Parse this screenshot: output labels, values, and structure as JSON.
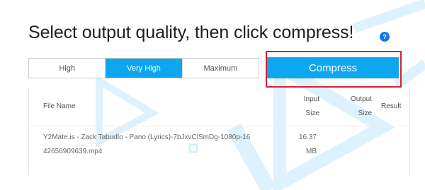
{
  "header": {
    "title": "Select output quality, then click compress!",
    "help_icon": "question-icon",
    "help_icon_glyph": "?"
  },
  "quality": {
    "options": [
      "High",
      "Very High",
      "Maximum"
    ],
    "selected": "Very High"
  },
  "compress": {
    "label": "Compress"
  },
  "table": {
    "headers": {
      "file_name": "File Name",
      "input_size": [
        "Input",
        "Size"
      ],
      "output_size": [
        "Output",
        "Size"
      ],
      "result": "Result"
    },
    "rows": [
      {
        "file_name_line1": "Y2Mate.is - Zack Tabudlo - Pano (Lyrics)-7bJxvClSmDg-1080p-16",
        "file_name_line2": "42656909639.mp4",
        "input_size_value": "16.37",
        "input_size_unit": "MB"
      }
    ]
  },
  "colors": {
    "accent": "#0fa6f0",
    "highlight_box": "#d4232f",
    "help_icon": "#1677e8"
  }
}
